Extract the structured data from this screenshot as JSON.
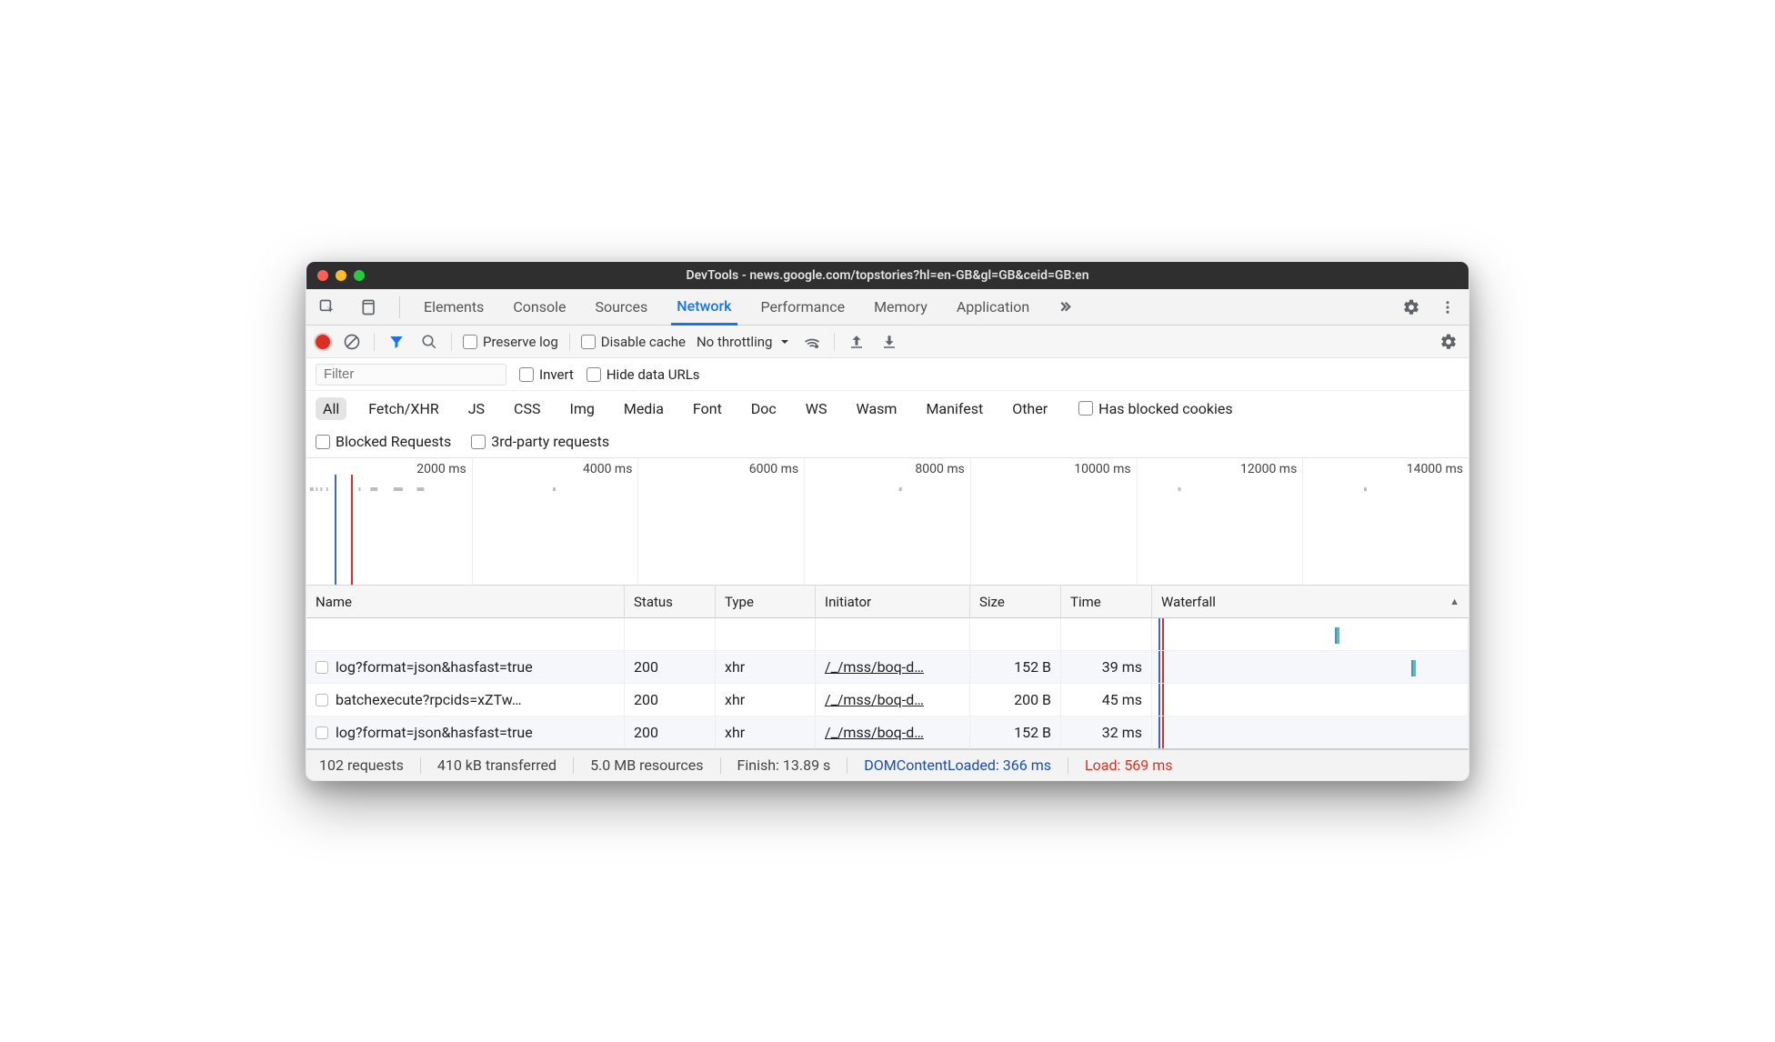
{
  "window": {
    "title": "DevTools - news.google.com/topstories?hl=en-GB&gl=GB&ceid=GB:en"
  },
  "tabs": {
    "items": [
      "Elements",
      "Console",
      "Sources",
      "Network",
      "Performance",
      "Memory",
      "Application"
    ],
    "active": "Network"
  },
  "toolbar": {
    "preserve_log": "Preserve log",
    "disable_cache": "Disable cache",
    "throttling": "No throttling"
  },
  "filterbar": {
    "placeholder": "Filter",
    "invert": "Invert",
    "hide_data_urls": "Hide data URLs"
  },
  "typebar": {
    "items": [
      "All",
      "Fetch/XHR",
      "JS",
      "CSS",
      "Img",
      "Media",
      "Font",
      "Doc",
      "WS",
      "Wasm",
      "Manifest",
      "Other"
    ],
    "active": "All",
    "has_blocked_cookies": "Has blocked cookies"
  },
  "extrabar": {
    "blocked_requests": "Blocked Requests",
    "third_party": "3rd-party requests"
  },
  "overview": {
    "ticks": [
      "2000 ms",
      "4000 ms",
      "6000 ms",
      "8000 ms",
      "10000 ms",
      "12000 ms",
      "14000 ms"
    ]
  },
  "columns": [
    "Name",
    "Status",
    "Type",
    "Initiator",
    "Size",
    "Time",
    "Waterfall"
  ],
  "rows": [
    {
      "name": "log?format=json&hasfast=true",
      "status": "200",
      "type": "xhr",
      "initiator": "/_/mss/boq-d…",
      "size": "152 B",
      "time": "39 ms"
    },
    {
      "name": "batchexecute?rpcids=xZTw…",
      "status": "200",
      "type": "xhr",
      "initiator": "/_/mss/boq-d…",
      "size": "200 B",
      "time": "45 ms"
    },
    {
      "name": "log?format=json&hasfast=true",
      "status": "200",
      "type": "xhr",
      "initiator": "/_/mss/boq-d…",
      "size": "152 B",
      "time": "32 ms"
    }
  ],
  "status": {
    "requests": "102 requests",
    "transferred": "410 kB transferred",
    "resources": "5.0 MB resources",
    "finish": "Finish: 13.89 s",
    "dom": "DOMContentLoaded: 366 ms",
    "load": "Load: 569 ms"
  }
}
